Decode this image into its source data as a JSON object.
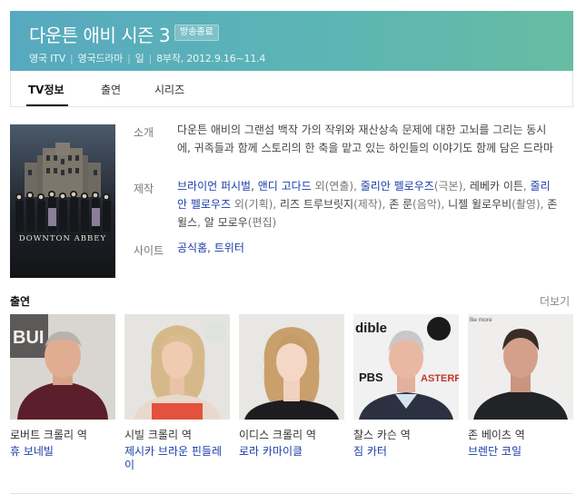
{
  "header": {
    "title": "다운튼 애비 시즌 3",
    "badge": "방송종료",
    "meta": [
      "영국 ITV",
      "영국드라마",
      "일",
      "8부작, 2012.9.16~11.4"
    ]
  },
  "tabs": [
    {
      "label": "TV정보",
      "active": true
    },
    {
      "label": "출연",
      "active": false
    },
    {
      "label": "시리즈",
      "active": false
    }
  ],
  "poster": {
    "text": "DOWNTON ABBEY"
  },
  "info": {
    "synopsis_label": "소개",
    "synopsis": "다운튼 애비의 그랜섬 백작 가의 작위와 재산상속 문제에 대한 고뇌를 그리는 동시에, 귀족들과 함께 스토리의 한 축을 맡고 있는 하인들의 이야기도 함께 담은 드라마",
    "production_label": "제작",
    "production": [
      {
        "name": "브라이언 퍼시벌",
        "role": ""
      },
      {
        "name": "앤디 고다드",
        "role": " 외(연출), "
      },
      {
        "name": "줄리안 펠로우즈",
        "role": "(극본), "
      },
      {
        "name": "레베카 이튼",
        "role": ", "
      },
      {
        "name": "줄리안 펠로우즈",
        "role": " 외(기획), "
      },
      {
        "name": "리즈 트루브릿지",
        "role": "(제작), "
      },
      {
        "name": "존 룬",
        "role": "(음악), "
      },
      {
        "name": "니젤 윌로우비",
        "role": "(촬영), "
      },
      {
        "name": "존 윌스",
        "role": ", "
      },
      {
        "name": "알 모로우",
        "role": "(편집)"
      }
    ],
    "site_label": "사이트",
    "sites": [
      "공식홈",
      "트위터"
    ]
  },
  "cast_section": {
    "title": "출연",
    "more": "더보기"
  },
  "cast": [
    {
      "role": "로버트 크롤리 역",
      "actor": "휴 보네빌"
    },
    {
      "role": "시빌 크롤리 역",
      "actor": "제시카 브라운 핀들레이"
    },
    {
      "role": "이디스 크롤리 역",
      "actor": "로라 카마이클"
    },
    {
      "role": "찰스 카슨 역",
      "actor": "짐 카터"
    },
    {
      "role": "존 베이츠 역",
      "actor": "브렌단 코일"
    }
  ],
  "photo_signs": [
    "BUI",
    "dible",
    "PBS",
    "ASTERP",
    "Be more"
  ]
}
